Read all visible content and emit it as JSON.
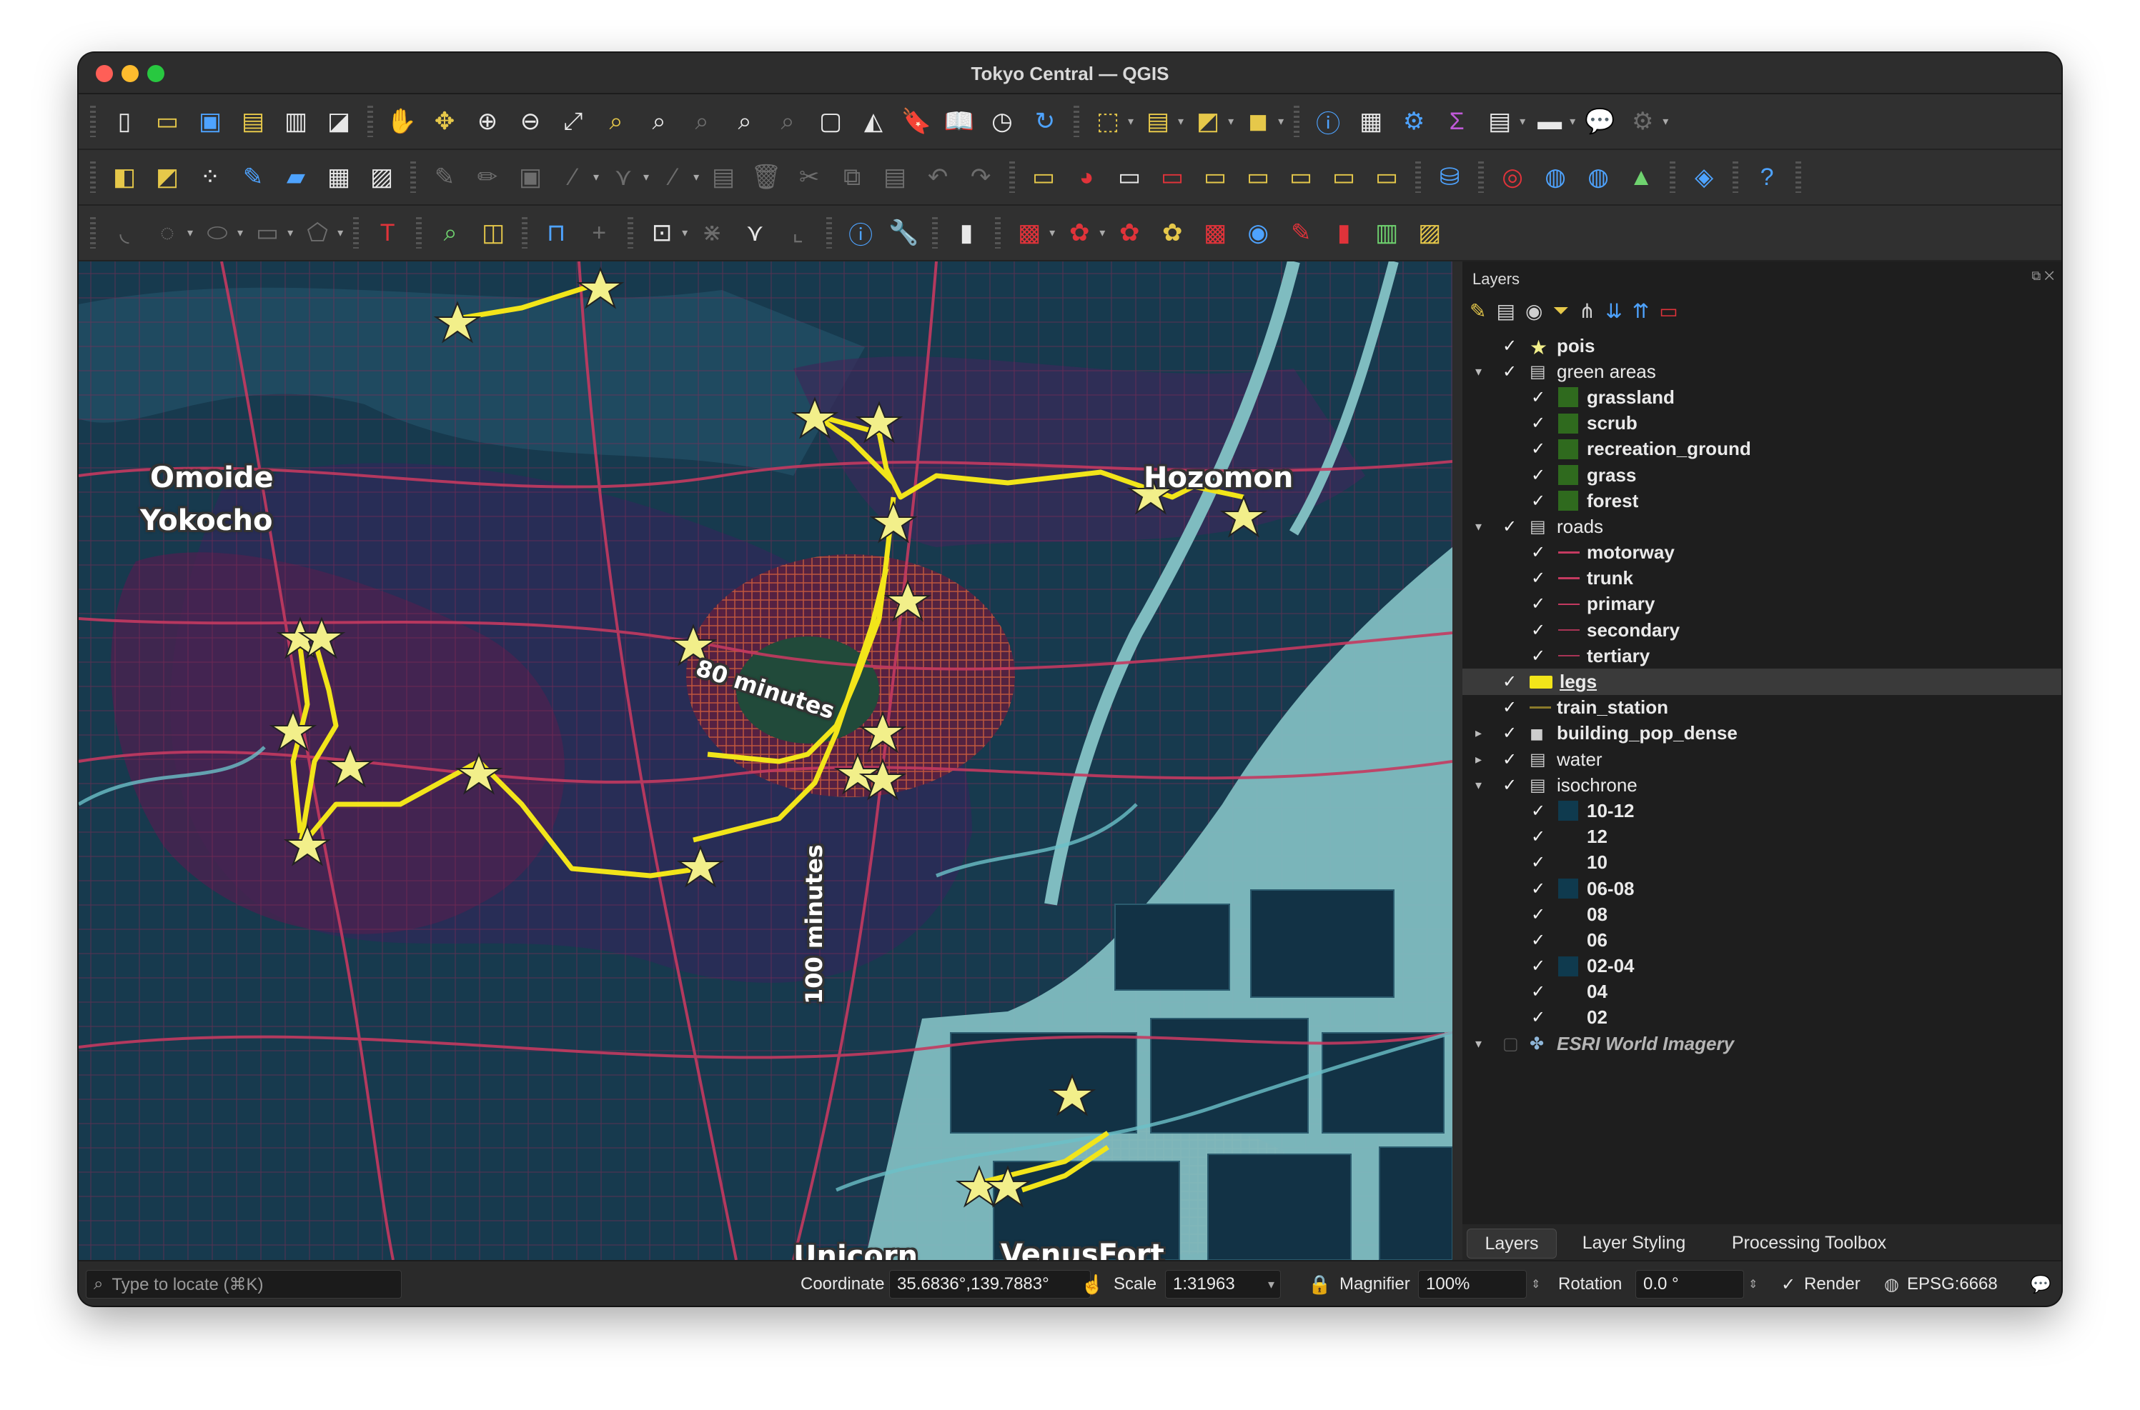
{
  "window": {
    "title": "Tokyo Central — QGIS"
  },
  "map": {
    "labels": {
      "omoide": "Omoide",
      "yokocho": "Yokocho",
      "hozomon": "Hozomon",
      "min80": "80 minutes",
      "min100": "100 minutes",
      "unicorn": "Unicorn",
      "venusfort": "VenusFort"
    }
  },
  "layers_panel": {
    "title": "Layers",
    "tree": [
      {
        "label": "pois",
        "checked": true,
        "symbol": "star"
      },
      {
        "label": "green areas",
        "checked": true,
        "group": true,
        "expanded": true
      },
      {
        "label": "grassland",
        "checked": true,
        "symbol": "fill-green"
      },
      {
        "label": "scrub",
        "checked": true,
        "symbol": "fill-green"
      },
      {
        "label": "recreation_ground",
        "checked": true,
        "symbol": "fill-green"
      },
      {
        "label": "grass",
        "checked": true,
        "symbol": "fill-green"
      },
      {
        "label": "forest",
        "checked": true,
        "symbol": "fill-green"
      },
      {
        "label": "roads",
        "checked": true,
        "group": true,
        "expanded": true
      },
      {
        "label": "motorway",
        "checked": true,
        "symbol": "line-red"
      },
      {
        "label": "trunk",
        "checked": true,
        "symbol": "line-red"
      },
      {
        "label": "primary",
        "checked": true,
        "symbol": "line-red"
      },
      {
        "label": "secondary",
        "checked": true,
        "symbol": "line-red"
      },
      {
        "label": "tertiary",
        "checked": true,
        "symbol": "line-red"
      },
      {
        "label": "legs",
        "checked": true,
        "symbol": "fill-yellow",
        "selected": true
      },
      {
        "label": "train_station",
        "checked": true,
        "symbol": "line-olive"
      },
      {
        "label": "building_pop_dense",
        "checked": true,
        "symbol": "group-3d"
      },
      {
        "label": "water",
        "checked": true,
        "group": true
      },
      {
        "label": "isochrone",
        "checked": true,
        "group": true,
        "expanded": true
      },
      {
        "label": "10-12",
        "checked": true,
        "symbol": "fill-teal"
      },
      {
        "label": "12",
        "checked": true,
        "symbol": "none"
      },
      {
        "label": "10",
        "checked": true,
        "symbol": "none"
      },
      {
        "label": "06-08",
        "checked": true,
        "symbol": "fill-teal"
      },
      {
        "label": "08",
        "checked": true,
        "symbol": "none"
      },
      {
        "label": "06",
        "checked": true,
        "symbol": "none"
      },
      {
        "label": "02-04",
        "checked": true,
        "symbol": "fill-teal"
      },
      {
        "label": "04",
        "checked": true,
        "symbol": "none"
      },
      {
        "label": "02",
        "checked": true,
        "symbol": "none"
      },
      {
        "label": "ESRI World Imagery",
        "checked": false,
        "symbol": "raster"
      }
    ],
    "tabs": [
      "Layers",
      "Layer Styling",
      "Processing Toolbox"
    ]
  },
  "statusbar": {
    "locator_placeholder": "Type to locate (⌘K)",
    "coordinate_label": "Coordinate",
    "coordinate_value": "35.6836°,139.7883°",
    "scale_label": "Scale",
    "scale_value": "1:31963",
    "magnifier_label": "Magnifier",
    "magnifier_value": "100%",
    "rotation_label": "Rotation",
    "rotation_value": "0.0 °",
    "render_label": "Render",
    "crs": "EPSG:6668"
  },
  "colors": {
    "map_bg": "#123245",
    "water": "#7fbcc0",
    "roads": "#c43a60",
    "legs": "#f2e51a",
    "isochrone_dark": "#0f3a4e"
  }
}
